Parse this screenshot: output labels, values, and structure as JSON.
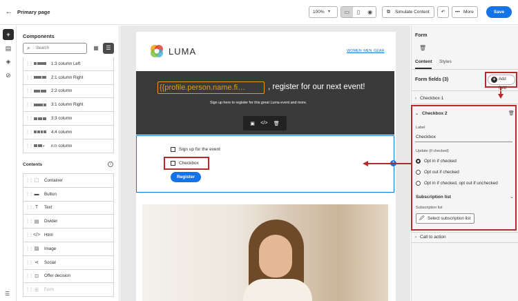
{
  "header": {
    "title": "Primary page",
    "zoom": "100%",
    "simulate_label": "Simulate Content",
    "more_label": "More",
    "save_label": "Save"
  },
  "components_panel": {
    "title": "Components",
    "search_placeholder": "Search",
    "structures": [
      "1:3 column Left",
      "2:1 column Right",
      "2:2 column",
      "3:1 column Right",
      "3:3 column",
      "4:4 column",
      "n:n column"
    ],
    "contents_title": "Contents",
    "contents": [
      {
        "label": "Container",
        "icon": "container-icon"
      },
      {
        "label": "Button",
        "icon": "button-icon"
      },
      {
        "label": "Text",
        "icon": "text-icon"
      },
      {
        "label": "Divider",
        "icon": "divider-icon"
      },
      {
        "label": "Html",
        "icon": "html-icon"
      },
      {
        "label": "Image",
        "icon": "image-icon"
      },
      {
        "label": "Social",
        "icon": "social-icon"
      },
      {
        "label": "Offer decision",
        "icon": "offer-decision-icon"
      },
      {
        "label": "Form",
        "icon": "form-icon"
      }
    ]
  },
  "email": {
    "brand": "LUMA",
    "nav": "WOMEN MEN GEAR",
    "personalization": "{{profile.person.name.fi…",
    "headline": ", register for our next event!",
    "subtext": "Sign up here to register for this great Luma event and more.",
    "form": {
      "checkbox1_label": "Sign up for the event",
      "checkbox2_label": "Checkbox",
      "button_label": "Register"
    }
  },
  "right_panel": {
    "title": "Form",
    "tabs": [
      "Content",
      "Styles"
    ],
    "form_fields_title": "Form fields (3)",
    "add_field_label": "Add field",
    "checkbox1": "Checkbox 1",
    "checkbox2": "Checkbox 2",
    "label_caption": "Label",
    "label_value": "Checkbox",
    "update_caption": "Update (if checked)",
    "options": [
      "Opt in if checked",
      "Opt out if checked",
      "Opt in if checked, opt out if unchecked"
    ],
    "subscription_title": "Subscription list",
    "subscription_caption": "Subscription list",
    "select_subscription_label": "Select subscription list",
    "call_to_action": "Call to action"
  },
  "colors": {
    "accent": "#1473e6",
    "annotation": "#b52a2a",
    "personalization": "#e59a1b"
  }
}
